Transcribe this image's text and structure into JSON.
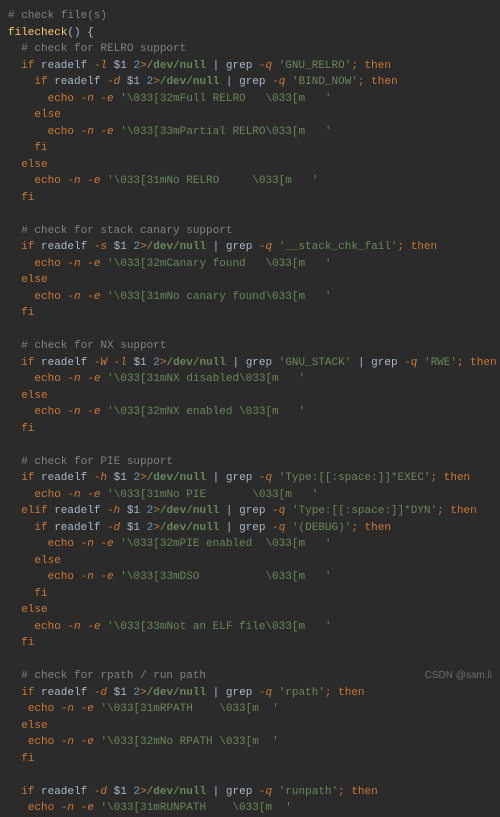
{
  "code": {
    "l1": "# check file(s)",
    "l2_fn": "filecheck",
    "l2_rest": "() {",
    "l3": "  # check for RELRO support",
    "l4_pre": "  ",
    "l4_if": "if",
    "l4_cmd": " readelf ",
    "l4_flag": "-l",
    "l4_var": " $1 ",
    "l4_num": "2",
    "l4_redir": ">",
    "l4_path": "/dev/null",
    "l4_pipe": " | ",
    "l4_grep": "grep ",
    "l4_gflag": "-q",
    "l4_str": " 'GNU_RELRO'",
    "l4_then": "; then",
    "l5_pre": "    ",
    "l5_if": "if",
    "l5_cmd": " readelf ",
    "l5_flag": "-d",
    "l5_var": " $1 ",
    "l5_num": "2",
    "l5_redir": ">",
    "l5_path": "/dev/null",
    "l5_pipe": " | ",
    "l5_grep": "grep ",
    "l5_gflag": "-q",
    "l5_str": " 'BIND_NOW'",
    "l5_then": "; then",
    "l6_pre": "      ",
    "l6_echo": "echo ",
    "l6_flags": "-n -e ",
    "l6_str": "'\\033[32mFull RELRO   \\033[m   '",
    "l7_pre": "    ",
    "l7": "else",
    "l8_pre": "      ",
    "l8_echo": "echo ",
    "l8_flags": "-n -e ",
    "l8_str": "'\\033[33mPartial RELRO\\033[m   '",
    "l9_pre": "    ",
    "l9": "fi",
    "l10_pre": "  ",
    "l10": "else",
    "l11_pre": "    ",
    "l11_echo": "echo ",
    "l11_flags": "-n -e ",
    "l11_str": "'\\033[31mNo RELRO     \\033[m   '",
    "l12_pre": "  ",
    "l12": "fi",
    "l13": " ",
    "l14": "  # check for stack canary support",
    "l15_pre": "  ",
    "l15_if": "if",
    "l15_cmd": " readelf ",
    "l15_flag": "-s",
    "l15_var": " $1 ",
    "l15_num": "2",
    "l15_redir": ">",
    "l15_path": "/dev/null",
    "l15_pipe": " | ",
    "l15_grep": "grep ",
    "l15_gflag": "-q",
    "l15_str": " '__stack_chk_fail'",
    "l15_then": "; then",
    "l16_pre": "    ",
    "l16_echo": "echo ",
    "l16_flags": "-n -e ",
    "l16_str": "'\\033[32mCanary found   \\033[m   '",
    "l17_pre": "  ",
    "l17": "else",
    "l18_pre": "    ",
    "l18_echo": "echo ",
    "l18_flags": "-n -e ",
    "l18_str": "'\\033[31mNo canary found\\033[m   '",
    "l19_pre": "  ",
    "l19": "fi",
    "l20": " ",
    "l21": "  # check for NX support",
    "l22_pre": "  ",
    "l22_if": "if",
    "l22_cmd": " readelf ",
    "l22_flag": "-W -l",
    "l22_var": " $1 ",
    "l22_num": "2",
    "l22_redir": ">",
    "l22_path": "/dev/null",
    "l22_pipe": " | ",
    "l22_grep": "grep ",
    "l22_str": "'GNU_STACK'",
    "l22_pipe2": " | ",
    "l22_grep2": "grep ",
    "l22_gflag2": "-q",
    "l22_str2": " 'RWE'",
    "l22_then": "; then",
    "l23_pre": "    ",
    "l23_echo": "echo ",
    "l23_flags": "-n -e ",
    "l23_str": "'\\033[31mNX disabled\\033[m   '",
    "l24_pre": "  ",
    "l24": "else",
    "l25_pre": "    ",
    "l25_echo": "echo ",
    "l25_flags": "-n -e ",
    "l25_str": "'\\033[32mNX enabled \\033[m   '",
    "l26_pre": "  ",
    "l26": "fi",
    "l27": " ",
    "l28": "  # check for PIE support",
    "l29_pre": "  ",
    "l29_if": "if",
    "l29_cmd": " readelf ",
    "l29_flag": "-h",
    "l29_var": " $1 ",
    "l29_num": "2",
    "l29_redir": ">",
    "l29_path": "/dev/null",
    "l29_pipe": " | ",
    "l29_grep": "grep ",
    "l29_gflag": "-q",
    "l29_str": " 'Type:[[:space:]]*EXEC'",
    "l29_then": "; then",
    "l30_pre": "    ",
    "l30_echo": "echo ",
    "l30_flags": "-n -e ",
    "l30_str": "'\\033[31mNo PIE       \\033[m   '",
    "l31_pre": "  ",
    "l31_elif": "elif",
    "l31_cmd": " readelf ",
    "l31_flag": "-h",
    "l31_var": " $1 ",
    "l31_num": "2",
    "l31_redir": ">",
    "l31_path": "/dev/null",
    "l31_pipe": " | ",
    "l31_grep": "grep ",
    "l31_gflag": "-q",
    "l31_str": " 'Type:[[:space:]]*DYN'",
    "l31_then": "; then",
    "l32_pre": "    ",
    "l32_if": "if",
    "l32_cmd": " readelf ",
    "l32_flag": "-d",
    "l32_var": " $1 ",
    "l32_num": "2",
    "l32_redir": ">",
    "l32_path": "/dev/null",
    "l32_pipe": " | ",
    "l32_grep": "grep ",
    "l32_gflag": "-q",
    "l32_str": " '(DEBUG)'",
    "l32_then": "; then",
    "l33_pre": "      ",
    "l33_echo": "echo ",
    "l33_flags": "-n -e ",
    "l33_str": "'\\033[32mPIE enabled  \\033[m   '",
    "l34_pre": "    ",
    "l34": "else",
    "l35_pre": "      ",
    "l35_echo": "echo ",
    "l35_flags": "-n -e ",
    "l35_str": "'\\033[33mDSO          \\033[m   '",
    "l36_pre": "    ",
    "l36": "fi",
    "l37_pre": "  ",
    "l37": "else",
    "l38_pre": "    ",
    "l38_echo": "echo ",
    "l38_flags": "-n -e ",
    "l38_str": "'\\033[33mNot an ELF file\\033[m   '",
    "l39_pre": "  ",
    "l39": "fi",
    "l40": " ",
    "l41": "  # check for rpath / run path",
    "l42_pre": "  ",
    "l42_if": "if",
    "l42_cmd": " readelf ",
    "l42_flag": "-d",
    "l42_var": " $1 ",
    "l42_num": "2",
    "l42_redir": ">",
    "l42_path": "/dev/null",
    "l42_pipe": " | ",
    "l42_grep": "grep ",
    "l42_gflag": "-q",
    "l42_str": " 'rpath'",
    "l42_then": "; then",
    "l43_pre": "   ",
    "l43_echo": "echo ",
    "l43_flags": "-n -e ",
    "l43_str": "'\\033[31mRPATH    \\033[m  '",
    "l44_pre": "  ",
    "l44": "else",
    "l45_pre": "   ",
    "l45_echo": "echo ",
    "l45_flags": "-n -e ",
    "l45_str": "'\\033[32mNo RPATH \\033[m  '",
    "l46_pre": "  ",
    "l46": "fi",
    "l47": " ",
    "l48_pre": "  ",
    "l48_if": "if",
    "l48_cmd": " readelf ",
    "l48_flag": "-d",
    "l48_var": " $1 ",
    "l48_num": "2",
    "l48_redir": ">",
    "l48_path": "/dev/null",
    "l48_pipe": " | ",
    "l48_grep": "grep ",
    "l48_gflag": "-q",
    "l48_str": " 'runpath'",
    "l48_then": "; then",
    "l49_pre": "   ",
    "l49_echo": "echo ",
    "l49_flags": "-n -e ",
    "l49_str": "'\\033[31mRUNPATH    \\033[m  '"
  },
  "watermark": "CSDN @sam.li"
}
